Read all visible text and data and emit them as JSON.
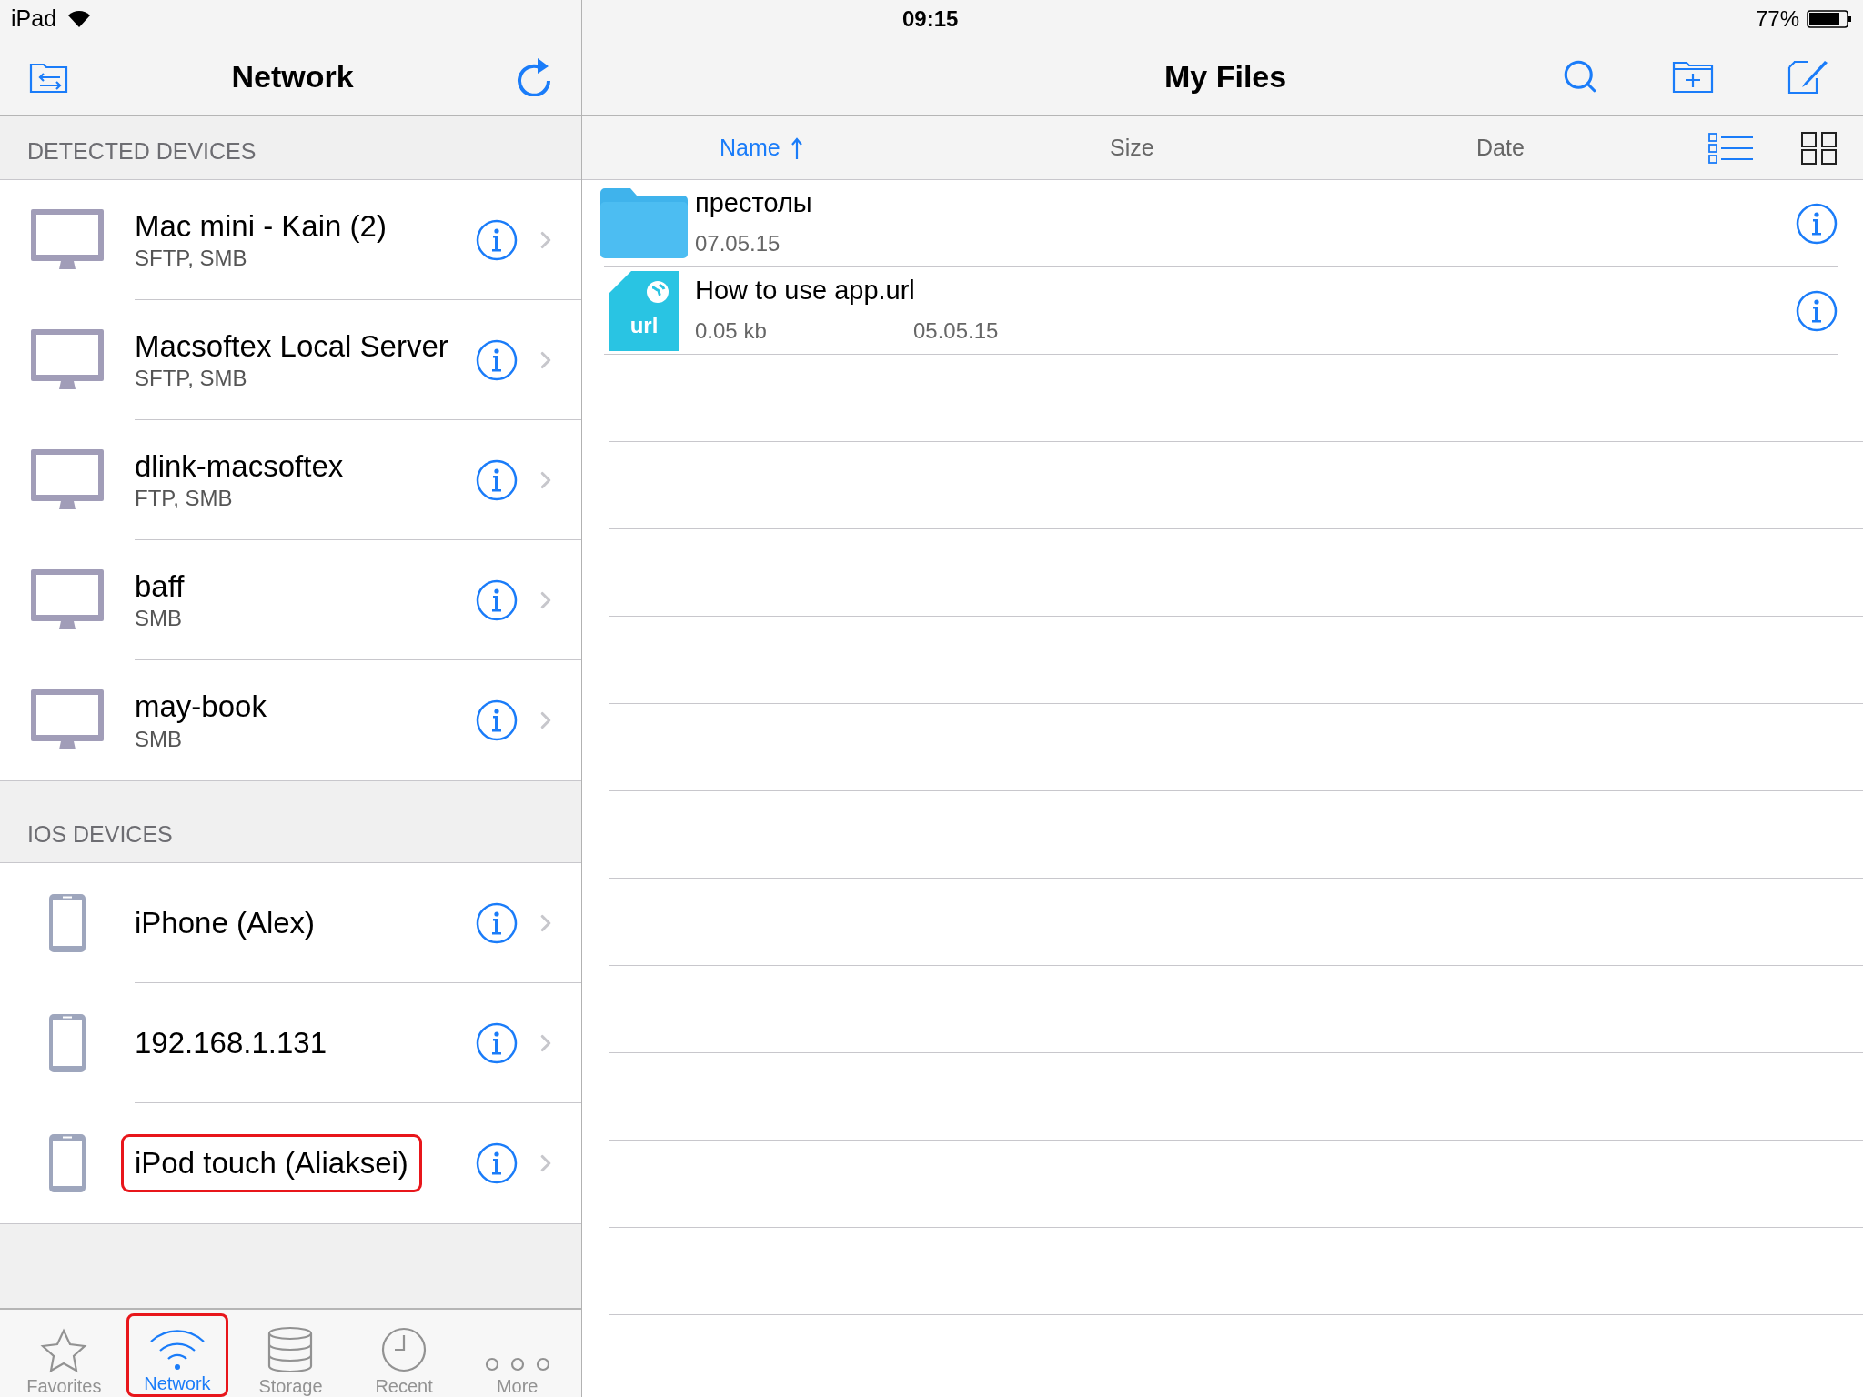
{
  "status_bar": {
    "device": "iPad",
    "time": "09:15",
    "battery": "77%"
  },
  "left_panel": {
    "title": "Network",
    "sections": [
      {
        "header": "DETECTED DEVICES",
        "devices": [
          {
            "kind": "computer",
            "name": "Mac mini - Kain (2)",
            "protocols": "SFTP, SMB",
            "highlighted": false
          },
          {
            "kind": "computer",
            "name": "Macsoftex Local Server",
            "protocols": "SFTP, SMB",
            "highlighted": false
          },
          {
            "kind": "computer",
            "name": "dlink-macsoftex",
            "protocols": "FTP, SMB",
            "highlighted": false
          },
          {
            "kind": "computer",
            "name": "baff",
            "protocols": "SMB",
            "highlighted": false
          },
          {
            "kind": "computer",
            "name": "may-book",
            "protocols": "SMB",
            "highlighted": false
          }
        ]
      },
      {
        "header": "IOS DEVICES",
        "devices": [
          {
            "kind": "phone",
            "name": "iPhone (Alex)",
            "highlighted": false
          },
          {
            "kind": "phone",
            "name": "192.168.1.131",
            "highlighted": false
          },
          {
            "kind": "phone",
            "name": "iPod touch (Aliaksei)",
            "highlighted": true
          }
        ]
      }
    ]
  },
  "tab_bar": [
    {
      "kind": "star",
      "label": "Favorites",
      "selected": false,
      "highlighted": false
    },
    {
      "kind": "wifi",
      "label": "Network",
      "selected": true,
      "highlighted": true
    },
    {
      "kind": "storage",
      "label": "Storage",
      "selected": false,
      "highlighted": false
    },
    {
      "kind": "clock",
      "label": "Recent",
      "selected": false,
      "highlighted": false
    },
    {
      "kind": "more",
      "label": "More",
      "selected": false,
      "highlighted": false
    }
  ],
  "right_panel": {
    "title": "My Files",
    "columns": [
      {
        "label": "Name",
        "selected": true
      },
      {
        "label": "Size",
        "selected": false
      },
      {
        "label": "Date",
        "selected": false
      }
    ],
    "view_modes": [
      {
        "kind": "list",
        "selected": true
      },
      {
        "kind": "grid",
        "selected": false
      }
    ],
    "files": [
      {
        "kind": "folder",
        "name": "престолы",
        "date": "07.05.15"
      },
      {
        "kind": "url",
        "name": "How to use app.url",
        "size": "0.05 kb",
        "date": "05.05.15",
        "icon_label": "url"
      }
    ]
  }
}
